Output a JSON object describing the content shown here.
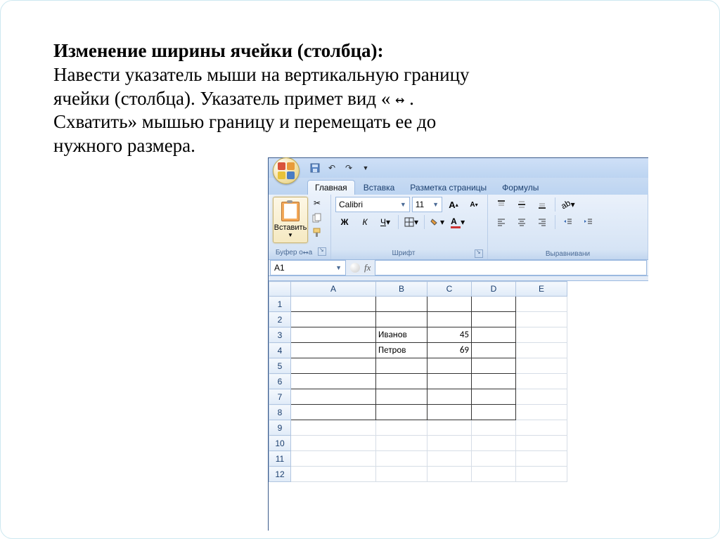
{
  "instruction": {
    "title": "Изменение ширины ячейки (столбца):",
    "line1": "Навести указатель мыши на вертикальную границу",
    "line2_a": "ячейки (столбца). Указатель примет вид    «",
    "line2_b": ".",
    "line3": "Схватить» мышью границу и перемещать ее до",
    "line4": "нужного размера.",
    "cursor_glyph": "↔"
  },
  "excel": {
    "tabs": {
      "home": "Главная",
      "insert": "Вставка",
      "page_layout": "Разметка страницы",
      "formulas": "Формулы"
    },
    "clipboard": {
      "paste": "Вставить",
      "group_label": "Буфер о"
    },
    "font": {
      "name": "Calibri",
      "size": "11",
      "bold": "Ж",
      "italic": "К",
      "underline": "Ч",
      "group_label": "Шрифт"
    },
    "alignment": {
      "group_label": "Выравнивани"
    },
    "namebox": "A1",
    "fx_label": "fx",
    "columns": [
      "A",
      "B",
      "C",
      "D",
      "E"
    ],
    "rows": [
      1,
      2,
      3,
      4,
      5,
      6,
      7,
      8,
      9,
      10,
      11,
      12
    ],
    "cells": {
      "B3": "Иванов",
      "C3": "45",
      "B4": "Петров",
      "C4": "69"
    },
    "resize_overlay_cursor": "↔",
    "clipboard_suffix": "а"
  }
}
